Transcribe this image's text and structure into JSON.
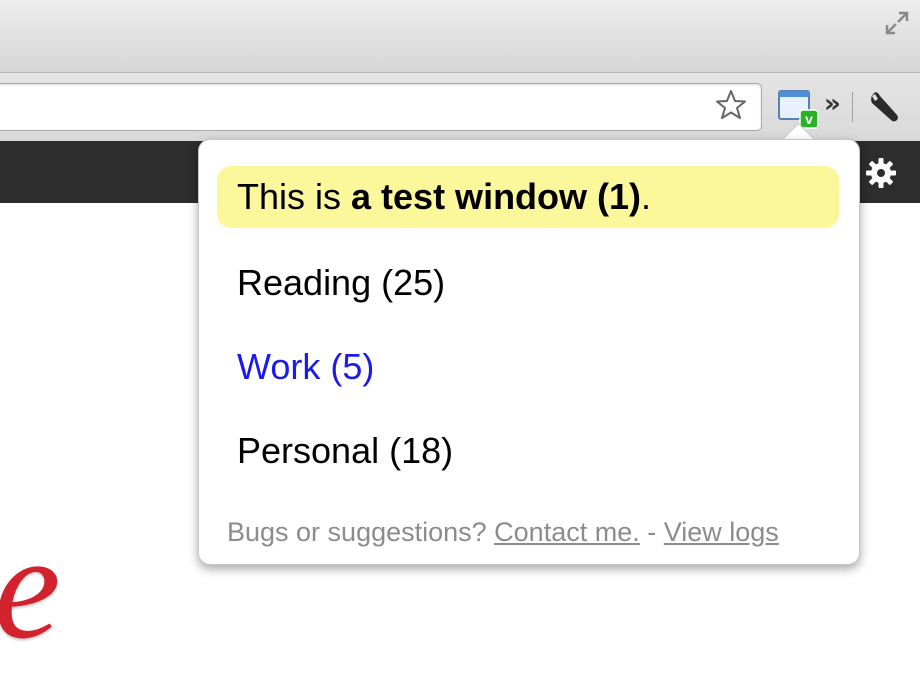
{
  "popup": {
    "current_window": {
      "prefix": "This is ",
      "name_bold": "a test window (1)",
      "suffix": "."
    },
    "windows": [
      {
        "label": "Reading (25)",
        "color": "#000000"
      },
      {
        "label": "Work (5)",
        "color": "#1a1aee"
      },
      {
        "label": "Personal (18)",
        "color": "#000000"
      }
    ],
    "footer": {
      "question": "Bugs or suggestions? ",
      "contact_link": "Contact me.",
      "separator": " - ",
      "logs_link": "View logs"
    }
  },
  "toolbar": {
    "overflow_label": "»",
    "extension_badge": "v"
  },
  "colors": {
    "highlight": "#fbf79b",
    "link_blue": "#1a1aee",
    "footer_gray": "#8c8c8c",
    "page_bar": "#2d2d2d"
  },
  "icons": [
    "fullscreen-icon",
    "star-icon",
    "extension-window-icon",
    "wrench-icon",
    "gear-icon"
  ]
}
